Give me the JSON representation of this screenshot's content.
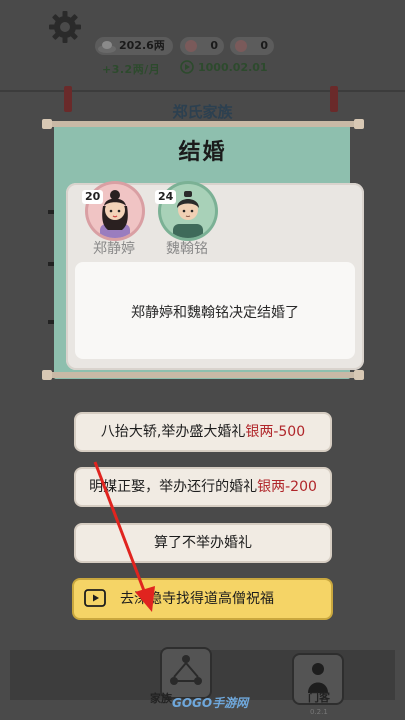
{
  "top_bar": {
    "silver": "202.6两",
    "res_a": "0",
    "res_b": "0",
    "status_left": "+3.2两/月",
    "date": "1000.02.01"
  },
  "clan_title": "郑氏家族",
  "dialog": {
    "title": "结婚",
    "female": {
      "name": "郑静婷",
      "age": "20"
    },
    "male": {
      "name": "魏翰铭",
      "age": "24"
    },
    "message": "郑静婷和魏翰铭决定结婚了"
  },
  "options": {
    "grand": {
      "label": "八抬大轿,举办盛大婚礼",
      "cost": "银两-500"
    },
    "simple": {
      "label": "明媒正娶，举办还行的婚礼",
      "cost": "银两-200"
    },
    "none": {
      "label": "算了不举办婚礼"
    },
    "blessing": {
      "label": "去深隐寺找得道高僧祝福"
    }
  },
  "nav": {
    "family_label": "家族",
    "door_label": "门客"
  },
  "watermark": "GOGO手游网",
  "version": "0.2.1",
  "colors": {
    "panel": "#8ebfae",
    "cost_red": "#b0262a",
    "blessing_yellow": "#f5d466",
    "arrow_red": "#e0241f"
  }
}
